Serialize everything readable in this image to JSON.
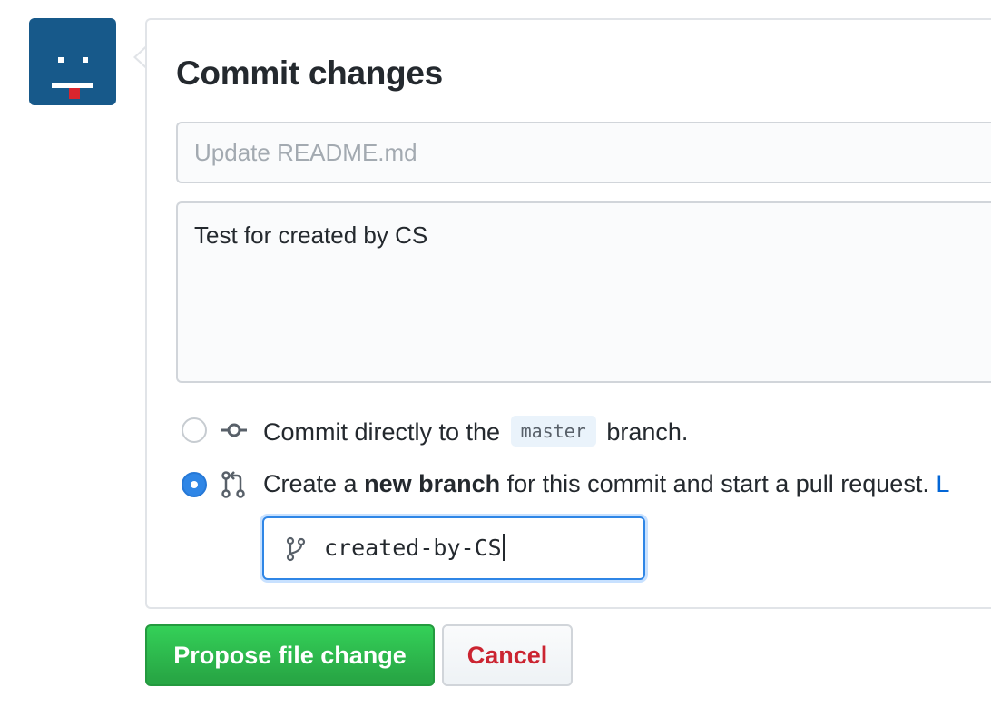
{
  "avatar": {
    "colors": {
      "background": "#17598a",
      "features": "#ffffff",
      "tongue": "#d8252e"
    }
  },
  "commit": {
    "title": "Commit changes",
    "summary_placeholder": "Update README.md",
    "description_value": "Test for created by CS",
    "options": {
      "direct": {
        "prefix": "Commit directly to the",
        "branch_code": "master",
        "suffix": "branch.",
        "selected": false,
        "icon": "git-commit-icon"
      },
      "new_branch": {
        "prefix": "Create a",
        "bold": "new branch",
        "suffix": "for this commit and start a pull request.",
        "link_fragment": "L",
        "selected": true,
        "icon": "git-pull-request-icon"
      }
    },
    "branch_name_value": "created-by-CS",
    "branch_icon": "git-branch-icon"
  },
  "buttons": {
    "propose": "Propose file change",
    "cancel": "Cancel"
  },
  "colors": {
    "primary_green": "#28a745",
    "cancel_red": "#cb2431",
    "radio_blue": "#2f86e6",
    "focus_blue": "#2f86e6"
  }
}
